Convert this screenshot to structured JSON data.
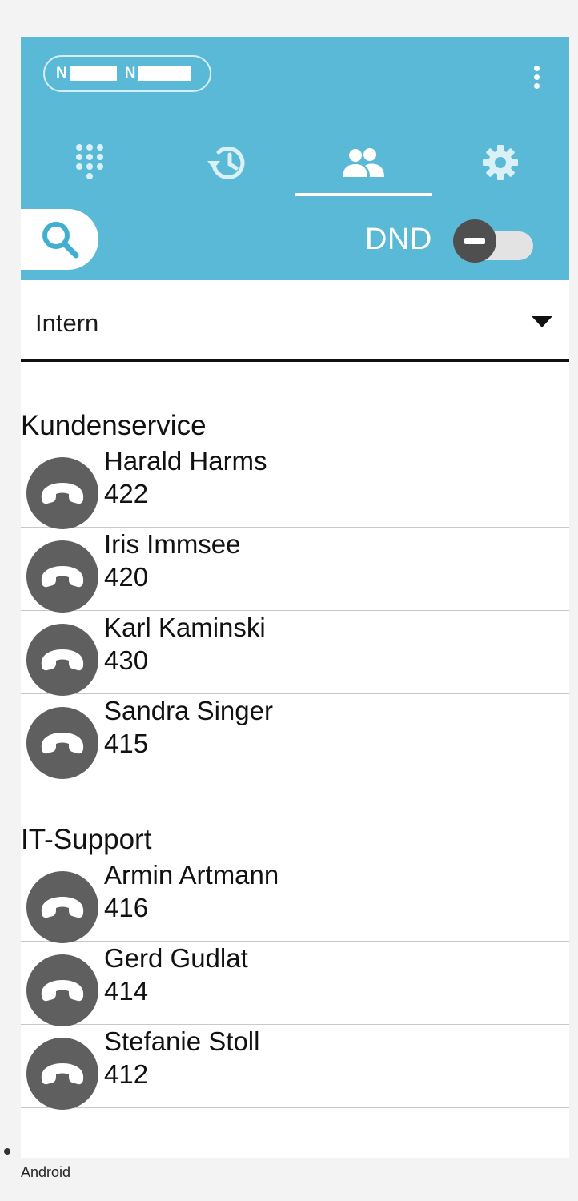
{
  "header": {
    "account": {
      "segments": [
        "N",
        "N"
      ]
    },
    "overflow_icon": "more-vert-icon",
    "tabs": [
      {
        "name": "dialpad",
        "icon": "dialpad-icon",
        "selected": false
      },
      {
        "name": "history",
        "icon": "history-icon",
        "selected": false
      },
      {
        "name": "contacts",
        "icon": "people-icon",
        "selected": true
      },
      {
        "name": "settings",
        "icon": "gear-icon",
        "selected": false
      }
    ],
    "search_icon": "search-icon",
    "dnd": {
      "label": "DND",
      "enabled": false,
      "thumb_icon": "do-not-disturb-icon"
    }
  },
  "group_select": {
    "value": "Intern",
    "icon": "dropdown-arrow-icon"
  },
  "groups": [
    {
      "title": "Kundenservice",
      "contacts": [
        {
          "name": "Harald Harms",
          "extension": "422"
        },
        {
          "name": "Iris Immsee",
          "extension": "420"
        },
        {
          "name": "Karl Kaminski",
          "extension": "430"
        },
        {
          "name": "Sandra Singer",
          "extension": "415"
        }
      ]
    },
    {
      "title": "IT-Support",
      "contacts": [
        {
          "name": "Armin Artmann",
          "extension": "416"
        },
        {
          "name": "Gerd Gudlat",
          "extension": "414"
        },
        {
          "name": "Stefanie Stoll",
          "extension": "412"
        }
      ]
    }
  ],
  "contact_icon": "phone-hangup-icon",
  "footer": {
    "platform": "Android"
  },
  "colors": {
    "header_bg": "#5ab9d6",
    "avatar_bg": "#5f5f5f",
    "thumb": "#4f4f4f",
    "page_bg": "#f3f3f3"
  }
}
